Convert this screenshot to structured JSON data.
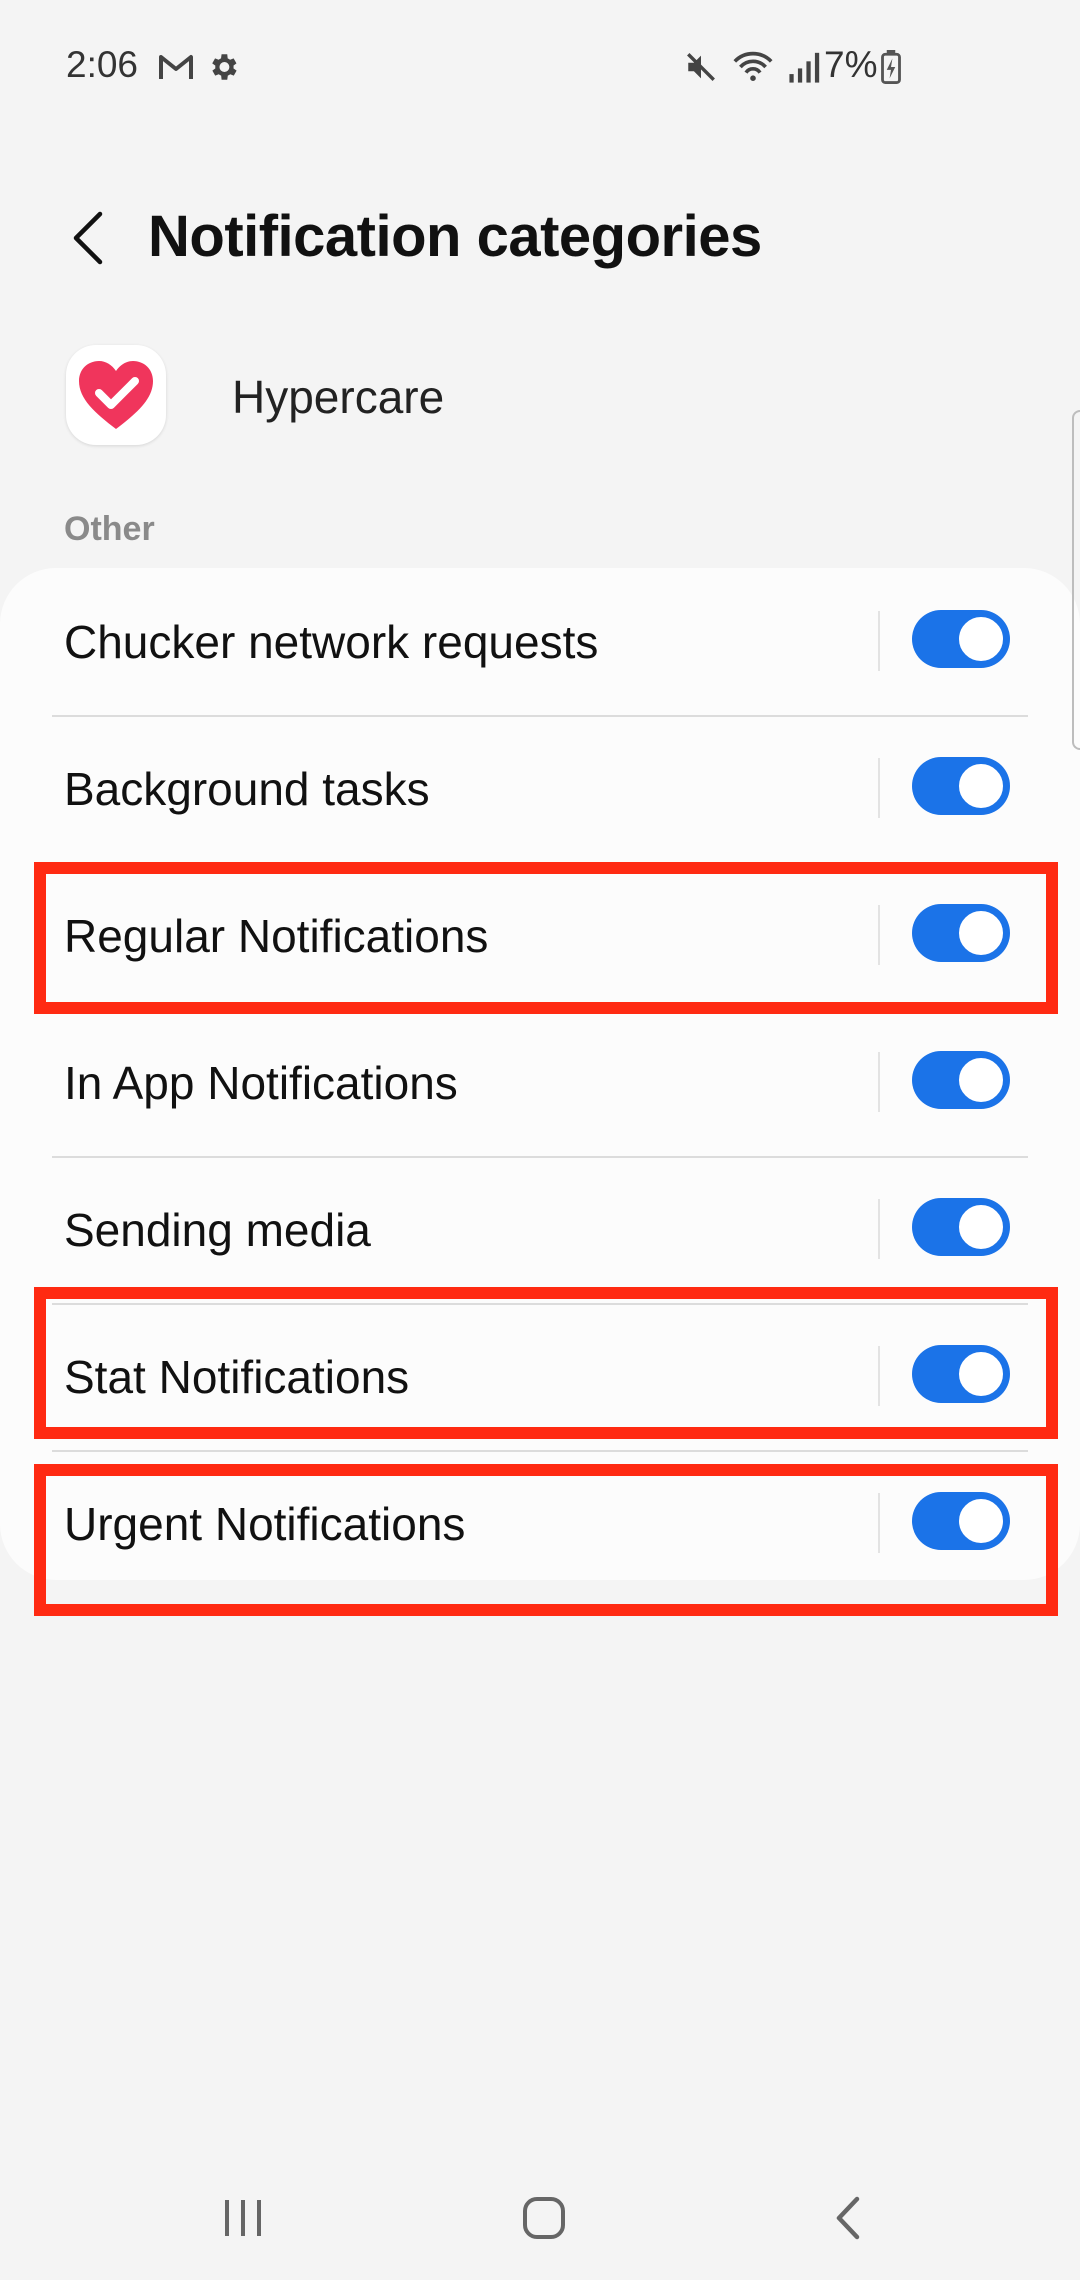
{
  "status": {
    "time": "2:06",
    "battery_text": "7%"
  },
  "header": {
    "title": "Notification categories"
  },
  "app": {
    "name": "Hypercare"
  },
  "section": {
    "label": "Other"
  },
  "categories": [
    {
      "label": "Chucker network requests",
      "enabled": true
    },
    {
      "label": "Background tasks",
      "enabled": true
    },
    {
      "label": "Regular Notifications",
      "enabled": true
    },
    {
      "label": "In App Notifications",
      "enabled": true
    },
    {
      "label": "Sending media",
      "enabled": true
    },
    {
      "label": "Stat Notifications",
      "enabled": true
    },
    {
      "label": "Urgent Notifications",
      "enabled": true
    }
  ],
  "highlighted": [
    "Regular Notifications",
    "Stat Notifications",
    "Urgent Notifications"
  ],
  "colors": {
    "toggle_on": "#1b73e8",
    "highlight": "#ff2a12",
    "app_icon_heart": "#f0355c"
  },
  "icons": {
    "back": "chevron-left-icon",
    "gmail": "gmail-icon",
    "settings": "gear-icon",
    "mute": "mute-icon",
    "wifi": "wifi-icon",
    "signal": "signal-icon",
    "battery": "battery-charging-icon",
    "nav_recent": "recent-apps-icon",
    "nav_home": "home-icon",
    "nav_back": "back-icon"
  }
}
